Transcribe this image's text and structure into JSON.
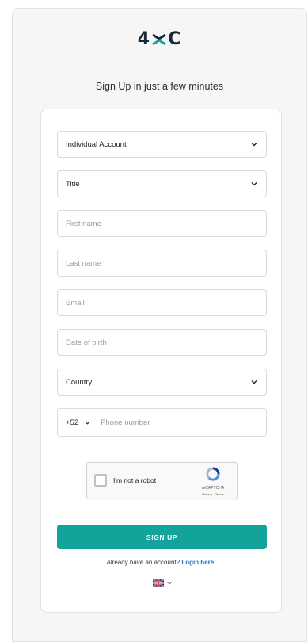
{
  "brand": {
    "logo_left": "4",
    "logo_right": "C",
    "logo_colors": {
      "text": "#172a3a",
      "accent": "#12a39b"
    }
  },
  "tagline": "Sign Up in just a few minutes",
  "form": {
    "account_type": {
      "value": "Individual Account"
    },
    "title": {
      "value": "Title"
    },
    "first_name": {
      "placeholder": "First name"
    },
    "last_name": {
      "placeholder": "Last name"
    },
    "email": {
      "placeholder": "Email"
    },
    "date_of_birth": {
      "placeholder": "Date of birth"
    },
    "country": {
      "value": "Country"
    },
    "phone": {
      "code": "+52",
      "placeholder": "Phone number"
    }
  },
  "captcha": {
    "label": "I'm not a robot",
    "brand": "reCAPTCHA",
    "links": "Privacy - Terms"
  },
  "signup_button": {
    "label": "SIGN UP",
    "color": "#12a39b"
  },
  "login_prompt": {
    "text": "Already have an account?",
    "link": "Login here.",
    "link_color": "#1a73c9"
  },
  "language": {
    "flag": "uk-flag-icon"
  }
}
